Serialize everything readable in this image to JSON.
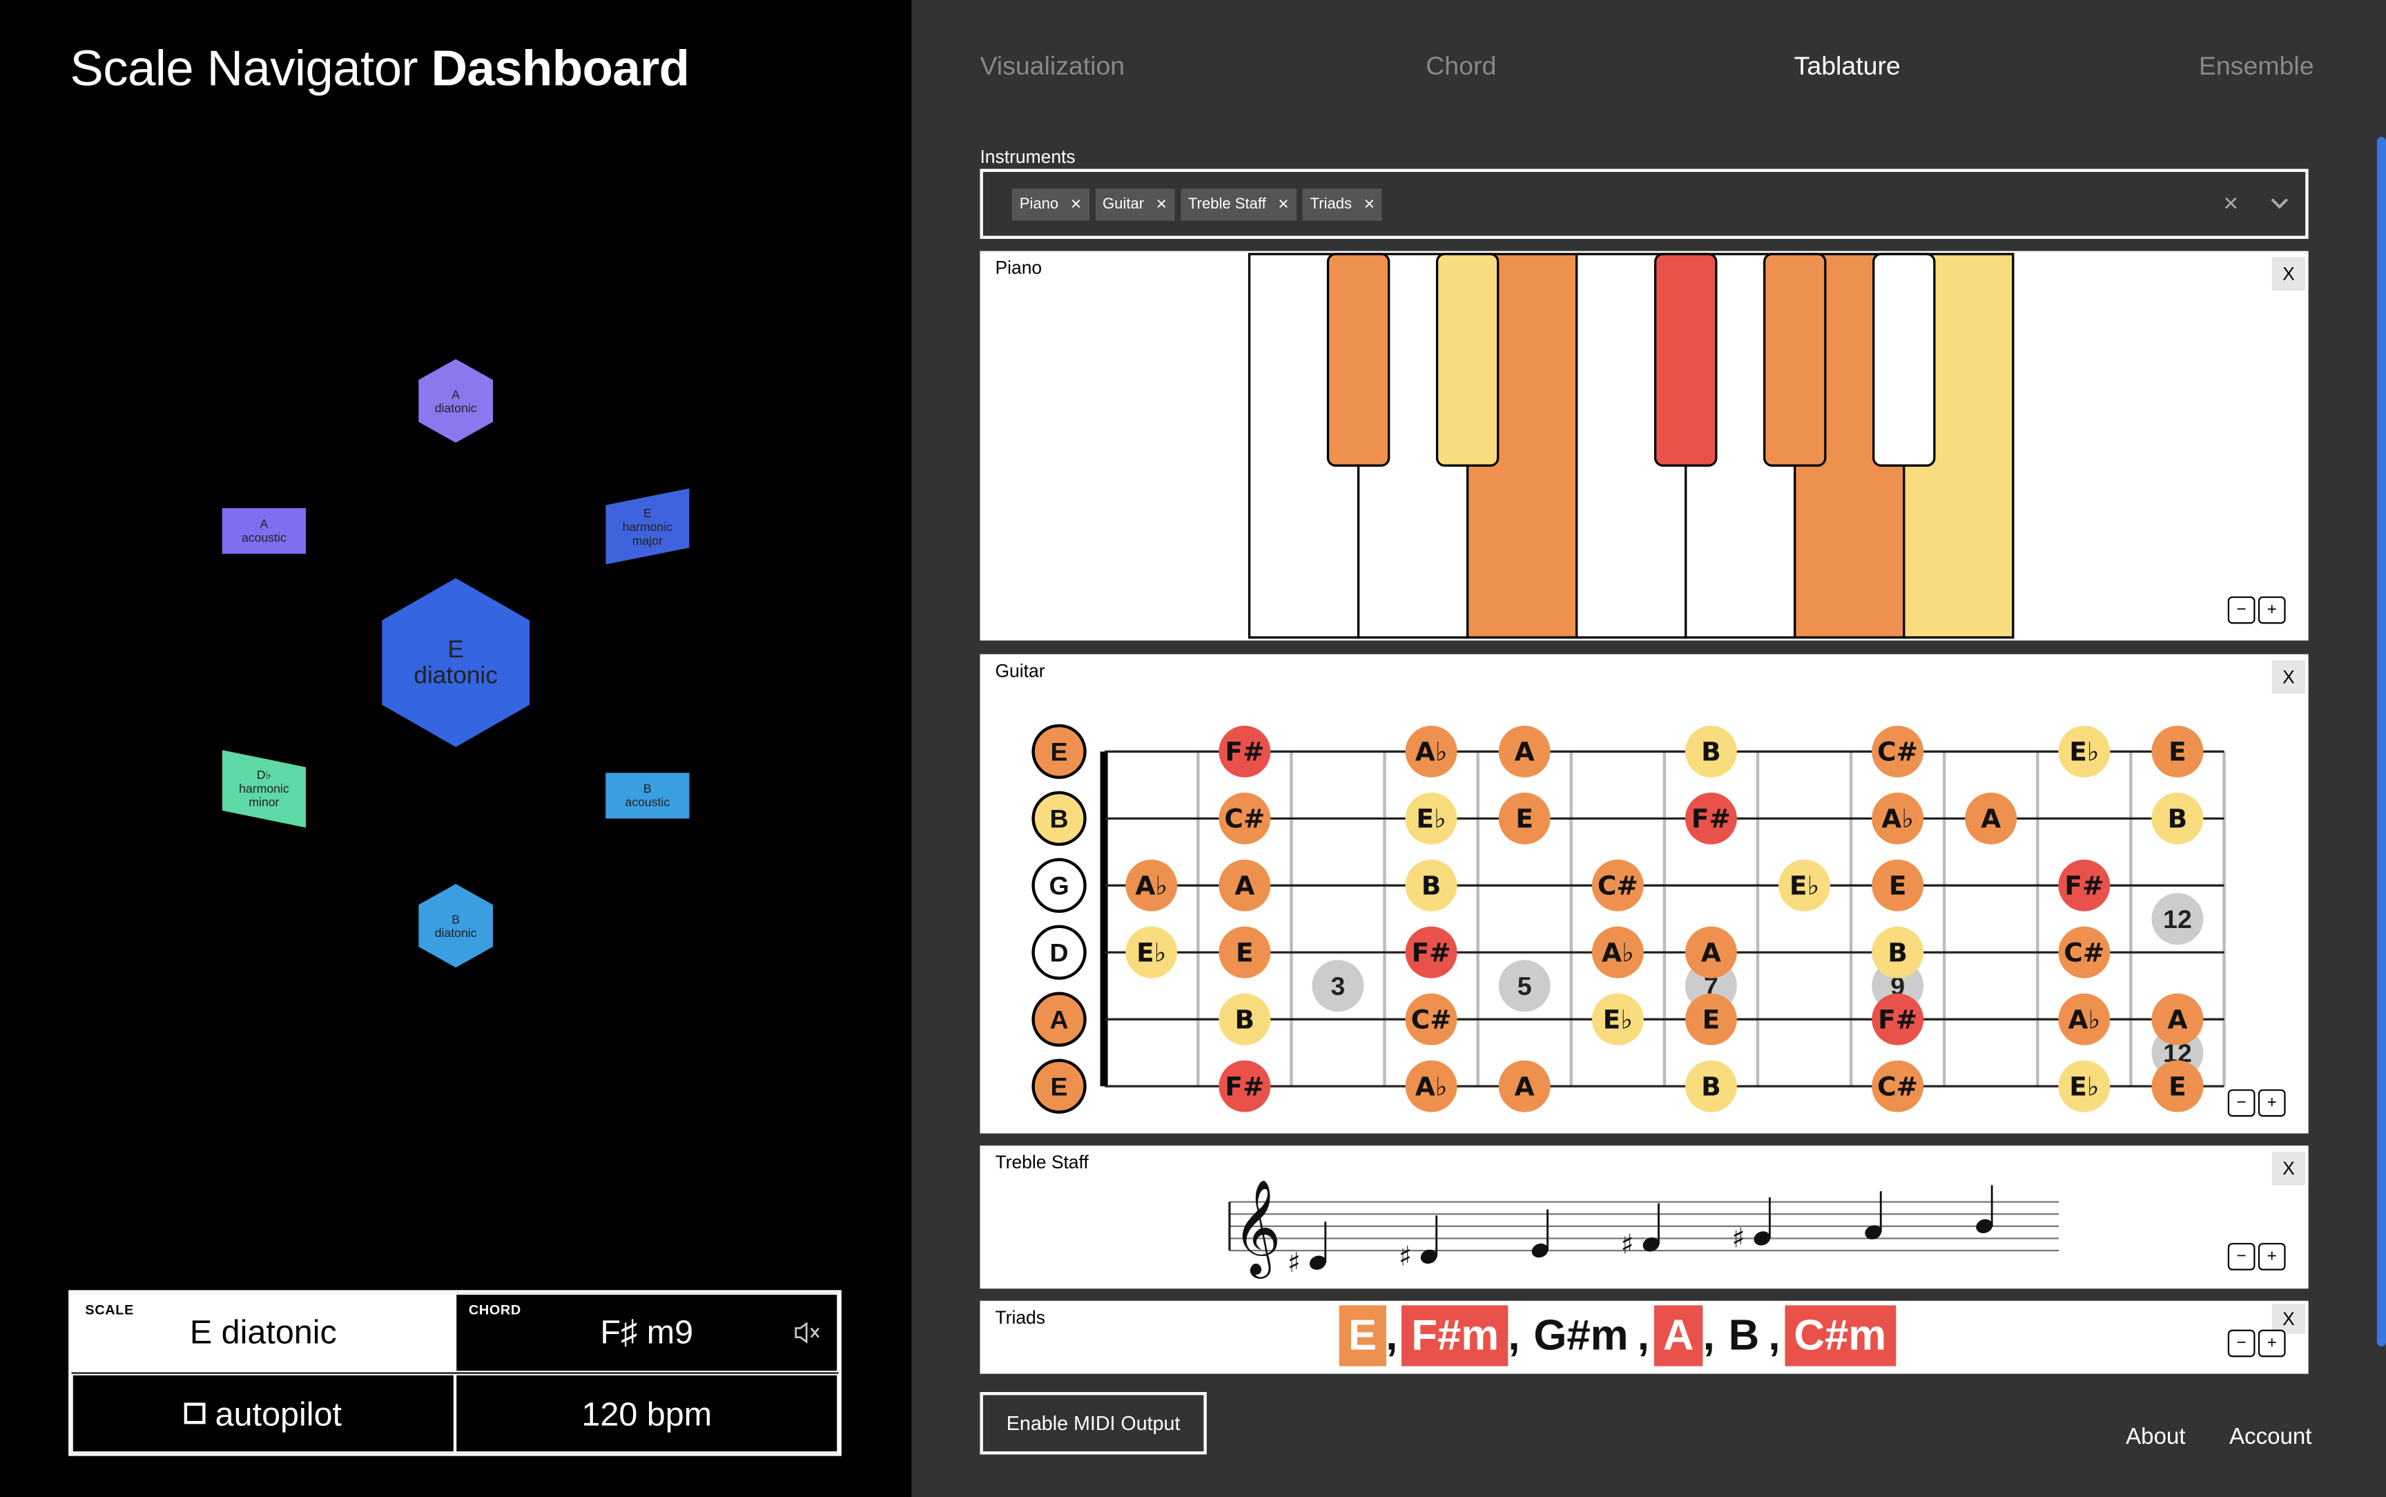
{
  "app_title": {
    "light": "Scale Navigator",
    "bold": "Dashboard"
  },
  "graph": {
    "nodes": [
      {
        "id": "a-diatonic",
        "label": [
          "A",
          "diatonic"
        ],
        "color": "#8b78ee"
      },
      {
        "id": "a-acoustic",
        "label": [
          "A",
          "acoustic"
        ],
        "color": "#7d6ff0"
      },
      {
        "id": "e-harmonic-major",
        "label": [
          "E",
          "harmonic",
          "major"
        ],
        "color": "#3f63dc"
      },
      {
        "id": "e-diatonic",
        "label": [
          "E",
          "diatonic"
        ],
        "color": "#3565e0"
      },
      {
        "id": "db-harmonic-minor",
        "label": [
          "D♭",
          "harmonic",
          "minor"
        ],
        "color": "#5ed8a4"
      },
      {
        "id": "b-acoustic",
        "label": [
          "B",
          "acoustic"
        ],
        "color": "#3a9fe0"
      },
      {
        "id": "b-diatonic",
        "label": [
          "B",
          "diatonic"
        ],
        "color": "#3a9ee0"
      }
    ]
  },
  "controls": {
    "scale_label": "SCALE",
    "scale_value": "E diatonic",
    "chord_label": "CHORD",
    "chord_value": "F♯ m9",
    "autopilot_label": "autopilot",
    "bpm_value": "120 bpm"
  },
  "tabs": [
    "Visualization",
    "Chord",
    "Tablature",
    "Ensemble"
  ],
  "active_tab": "Tablature",
  "instruments": {
    "label": "Instruments",
    "selected": [
      "Piano",
      "Guitar",
      "Treble Staff",
      "Triads"
    ]
  },
  "panels": {
    "piano": {
      "title": "Piano",
      "close": "X"
    },
    "guitar": {
      "title": "Guitar",
      "close": "X"
    },
    "staff": {
      "title": "Treble Staff",
      "close": "X"
    },
    "triads": {
      "title": "Triads",
      "close": "X"
    }
  },
  "zoom": {
    "minus": "−",
    "plus": "+"
  },
  "colors": {
    "root": "#ee914f",
    "chord": "#ee914f",
    "chord_light": "#f9dc7e",
    "accent": "#e9524a",
    "gray": "#cccccc"
  },
  "piano": {
    "white_keys": [
      {
        "note": "B",
        "color": "#ffffff"
      },
      {
        "note": "C",
        "color": "#ffffff"
      },
      {
        "note": "D",
        "color": "#ee914f"
      },
      {
        "note": "E",
        "color": "#ffffff"
      },
      {
        "note": "F",
        "color": "#ffffff"
      },
      {
        "note": "G",
        "color": "#ee914f"
      },
      {
        "note": "A",
        "color": "#f9dc7e"
      }
    ],
    "black_keys": [
      {
        "note": "C#",
        "color": "#ee914f"
      },
      {
        "note": "D#",
        "color": "#f9dc7e"
      },
      {
        "note": "F#",
        "color": "#e9524a"
      },
      {
        "note": "G#",
        "color": "#ee914f"
      },
      {
        "note": "A#",
        "color": "#ffffff"
      }
    ]
  },
  "guitar": {
    "strings": [
      {
        "name": "E",
        "color": "#ee914f"
      },
      {
        "name": "B",
        "color": "#f9dc7e"
      },
      {
        "name": "G",
        "color": "#ffffff"
      },
      {
        "name": "D",
        "color": "#ffffff"
      },
      {
        "name": "A",
        "color": "#ee914f"
      },
      {
        "name": "E",
        "color": "#ee914f"
      }
    ],
    "fret_markers": [
      {
        "label": "3",
        "fret": 3,
        "pos": 3.5
      },
      {
        "label": "5",
        "fret": 5,
        "pos": 3.5
      },
      {
        "label": "7",
        "fret": 7,
        "pos": 3.5
      },
      {
        "label": "9",
        "fret": 9,
        "pos": 3.5
      },
      {
        "label": "12",
        "fret": 12,
        "pos": 2.5
      },
      {
        "label": "12",
        "fret": 12,
        "pos": 4.5
      }
    ],
    "notes": [
      {
        "s": 0,
        "f": 2,
        "n": "F#",
        "c": "#e9524a"
      },
      {
        "s": 0,
        "f": 4,
        "n": "A♭",
        "c": "#ee914f"
      },
      {
        "s": 0,
        "f": 5,
        "n": "A",
        "c": "#ee914f"
      },
      {
        "s": 0,
        "f": 7,
        "n": "B",
        "c": "#f9dc7e"
      },
      {
        "s": 0,
        "f": 9,
        "n": "C#",
        "c": "#ee914f"
      },
      {
        "s": 0,
        "f": 11,
        "n": "E♭",
        "c": "#f9dc7e"
      },
      {
        "s": 0,
        "f": 12,
        "n": "E",
        "c": "#ee914f"
      },
      {
        "s": 1,
        "f": 2,
        "n": "C#",
        "c": "#ee914f"
      },
      {
        "s": 1,
        "f": 4,
        "n": "E♭",
        "c": "#f9dc7e"
      },
      {
        "s": 1,
        "f": 5,
        "n": "E",
        "c": "#ee914f"
      },
      {
        "s": 1,
        "f": 7,
        "n": "F#",
        "c": "#e9524a"
      },
      {
        "s": 1,
        "f": 9,
        "n": "A♭",
        "c": "#ee914f"
      },
      {
        "s": 1,
        "f": 10,
        "n": "A",
        "c": "#ee914f"
      },
      {
        "s": 1,
        "f": 12,
        "n": "B",
        "c": "#f9dc7e"
      },
      {
        "s": 2,
        "f": 1,
        "n": "A♭",
        "c": "#ee914f"
      },
      {
        "s": 2,
        "f": 2,
        "n": "A",
        "c": "#ee914f"
      },
      {
        "s": 2,
        "f": 4,
        "n": "B",
        "c": "#f9dc7e"
      },
      {
        "s": 2,
        "f": 6,
        "n": "C#",
        "c": "#ee914f"
      },
      {
        "s": 2,
        "f": 8,
        "n": "E♭",
        "c": "#f9dc7e"
      },
      {
        "s": 2,
        "f": 9,
        "n": "E",
        "c": "#ee914f"
      },
      {
        "s": 2,
        "f": 11,
        "n": "F#",
        "c": "#e9524a"
      },
      {
        "s": 3,
        "f": 1,
        "n": "E♭",
        "c": "#f9dc7e"
      },
      {
        "s": 3,
        "f": 2,
        "n": "E",
        "c": "#ee914f"
      },
      {
        "s": 3,
        "f": 4,
        "n": "F#",
        "c": "#e9524a"
      },
      {
        "s": 3,
        "f": 6,
        "n": "A♭",
        "c": "#ee914f"
      },
      {
        "s": 3,
        "f": 7,
        "n": "A",
        "c": "#ee914f"
      },
      {
        "s": 3,
        "f": 9,
        "n": "B",
        "c": "#f9dc7e"
      },
      {
        "s": 3,
        "f": 11,
        "n": "C#",
        "c": "#ee914f"
      },
      {
        "s": 4,
        "f": 2,
        "n": "B",
        "c": "#f9dc7e"
      },
      {
        "s": 4,
        "f": 4,
        "n": "C#",
        "c": "#ee914f"
      },
      {
        "s": 4,
        "f": 6,
        "n": "E♭",
        "c": "#f9dc7e"
      },
      {
        "s": 4,
        "f": 7,
        "n": "E",
        "c": "#ee914f"
      },
      {
        "s": 4,
        "f": 9,
        "n": "F#",
        "c": "#e9524a"
      },
      {
        "s": 4,
        "f": 11,
        "n": "A♭",
        "c": "#ee914f"
      },
      {
        "s": 4,
        "f": 12,
        "n": "A",
        "c": "#ee914f"
      },
      {
        "s": 5,
        "f": 2,
        "n": "F#",
        "c": "#e9524a"
      },
      {
        "s": 5,
        "f": 4,
        "n": "A♭",
        "c": "#ee914f"
      },
      {
        "s": 5,
        "f": 5,
        "n": "A",
        "c": "#ee914f"
      },
      {
        "s": 5,
        "f": 7,
        "n": "B",
        "c": "#f9dc7e"
      },
      {
        "s": 5,
        "f": 9,
        "n": "C#",
        "c": "#ee914f"
      },
      {
        "s": 5,
        "f": 11,
        "n": "E♭",
        "c": "#f9dc7e"
      },
      {
        "s": 5,
        "f": 12,
        "n": "E",
        "c": "#ee914f"
      }
    ]
  },
  "staff": {
    "notes": [
      {
        "acc": "♯",
        "step": -1
      },
      {
        "acc": "♯",
        "step": 0
      },
      {
        "acc": "",
        "step": 1
      },
      {
        "acc": "♯",
        "step": 2
      },
      {
        "acc": "♯",
        "step": 3
      },
      {
        "acc": "",
        "step": 4
      },
      {
        "acc": "",
        "step": 5
      }
    ]
  },
  "triads": [
    {
      "t": "E",
      "bg": "#ee914f",
      "color": "#ffffff"
    },
    {
      "t": "F#m",
      "bg": "#e9524a",
      "color": "#ffffff"
    },
    {
      "t": "G#m",
      "bg": "transparent",
      "color": "#111111"
    },
    {
      "t": "A",
      "bg": "#e9524a",
      "color": "#ffffff"
    },
    {
      "t": "B",
      "bg": "transparent",
      "color": "#111111"
    },
    {
      "t": "C#m",
      "bg": "#e9524a",
      "color": "#ffffff"
    }
  ],
  "midi_button": "Enable MIDI Output",
  "footer": {
    "about": "About",
    "account": "Account"
  }
}
